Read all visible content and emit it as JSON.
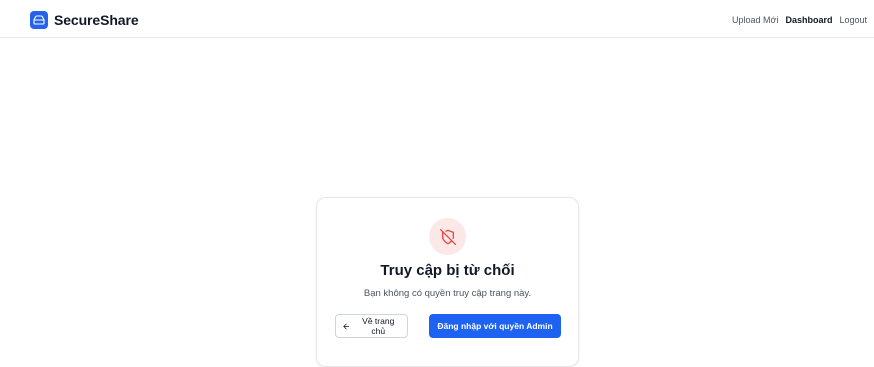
{
  "header": {
    "brand_name": "SecureShare",
    "nav": {
      "upload": "Upload Mới",
      "dashboard": "Dashboard",
      "logout": "Logout"
    }
  },
  "card": {
    "icon": "shield-off-icon",
    "title": "Truy cập bị từ chối",
    "message": "Bạn không có quyền truy cập trang này.",
    "back_icon": "arrow-left-icon",
    "back_label": "Về trang chủ",
    "admin_label": "Đăng nhập với quyền Admin"
  },
  "colors": {
    "primary": "#1d62f0",
    "danger": "#ef4444",
    "danger_bg": "#fde8e8"
  }
}
